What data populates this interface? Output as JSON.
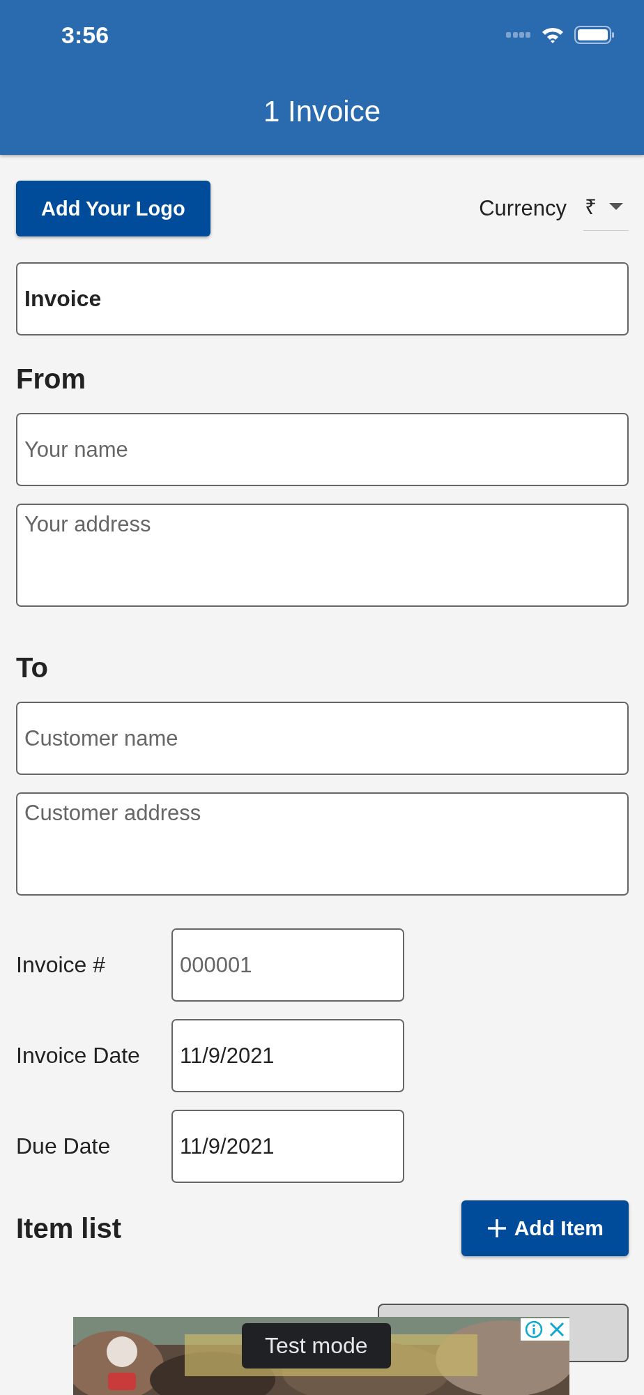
{
  "status_bar": {
    "time": "3:56"
  },
  "header": {
    "title": "1 Invoice"
  },
  "toolbar": {
    "logo_button": "Add Your Logo",
    "currency_label": "Currency",
    "currency_value": "₹"
  },
  "title_field": {
    "value": "Invoice"
  },
  "sections": [
    {
      "heading": "From",
      "fields": [
        {
          "kind": "input",
          "placeholder": "Your name"
        },
        {
          "kind": "textarea",
          "placeholder": "Your address"
        }
      ]
    },
    {
      "heading": "To",
      "fields": [
        {
          "kind": "input",
          "placeholder": "Customer name"
        },
        {
          "kind": "textarea",
          "placeholder": "Customer address"
        }
      ]
    }
  ],
  "details": [
    {
      "label": "Invoice #",
      "placeholder": "000001"
    },
    {
      "label": "Invoice Date",
      "value": "11/9/2021"
    },
    {
      "label": "Due Date",
      "value": "11/9/2021"
    }
  ],
  "items": {
    "heading": "Item list",
    "add_button": "Add Item"
  },
  "ad": {
    "kind": "picture",
    "badge": "Test mode"
  }
}
